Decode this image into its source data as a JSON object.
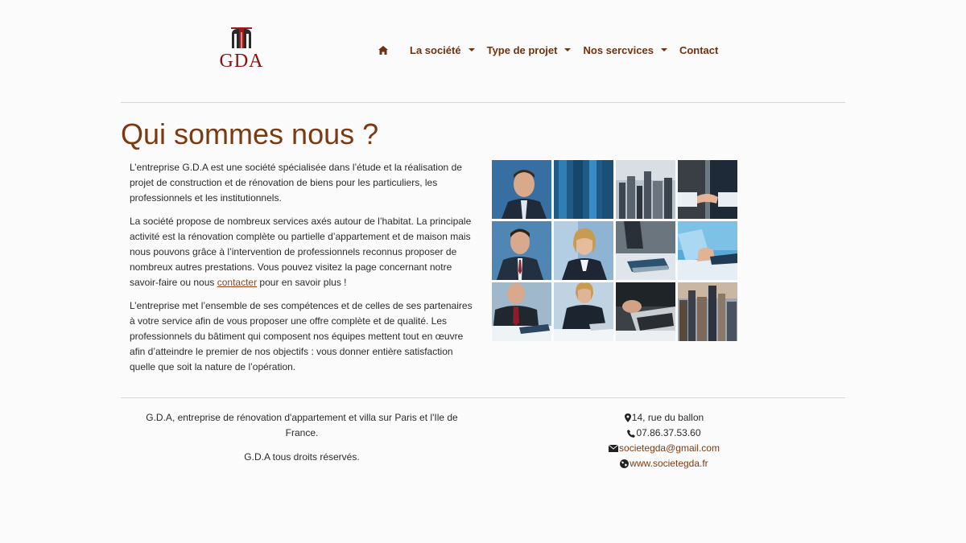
{
  "brand": {
    "name": "GDA"
  },
  "nav": {
    "home_icon": "home-icon",
    "items": [
      {
        "label": "La société",
        "dropdown": true
      },
      {
        "label": "Type de projet",
        "dropdown": true
      },
      {
        "label": "Nos sercvices",
        "dropdown": true
      },
      {
        "label": "Contact",
        "dropdown": false
      }
    ]
  },
  "main": {
    "title": "Qui sommes nous ?",
    "paragraphs": [
      "L’entreprise G.D.A est une société spécialisée dans l’étude et la réalisation de projet de construction et de rénovation de biens pour les particuliers, les professionnels et les institutionnels.",
      "L’entreprise met l’ensemble de ses compétences et de celles de ses partenaires à votre service afin de vous proposer une offre complète et de qualité. Les professionnels du bâtiment qui composent nos équipes mettent tout en œuvre afin d’atteindre le premier de nos objectifs : vous donner entière satisfaction quelle que soit la nature de l’opération."
    ],
    "p2": {
      "before": "La société propose de nombreux services axés autour de l’habitat. La principale activité est la rénovation complète ou partielle d’appartement et de maison mais nous pouvons grâce à l’intervention de professionnels reconnus proposer de nombreux autres prestations. Vous pouvez visitez la page concernant notre savoir-faire ou nous ",
      "link": "contacter",
      "after": " pour en savoir plus !"
    }
  },
  "footer": {
    "description": "G.D.A, entreprise de rénovation d'appartement et villa sur Paris et l'Ile de France.",
    "rights": "G.D.A tous droits réservés.",
    "address": "14, rue du ballon",
    "phone": "07.86.37.53.60",
    "email": "societegda@gmail.com",
    "website": "www.societegda.fr"
  },
  "colors": {
    "accent": "#7a3b12",
    "nav_text": "#6e3210",
    "logo_red": "#8a1010"
  }
}
